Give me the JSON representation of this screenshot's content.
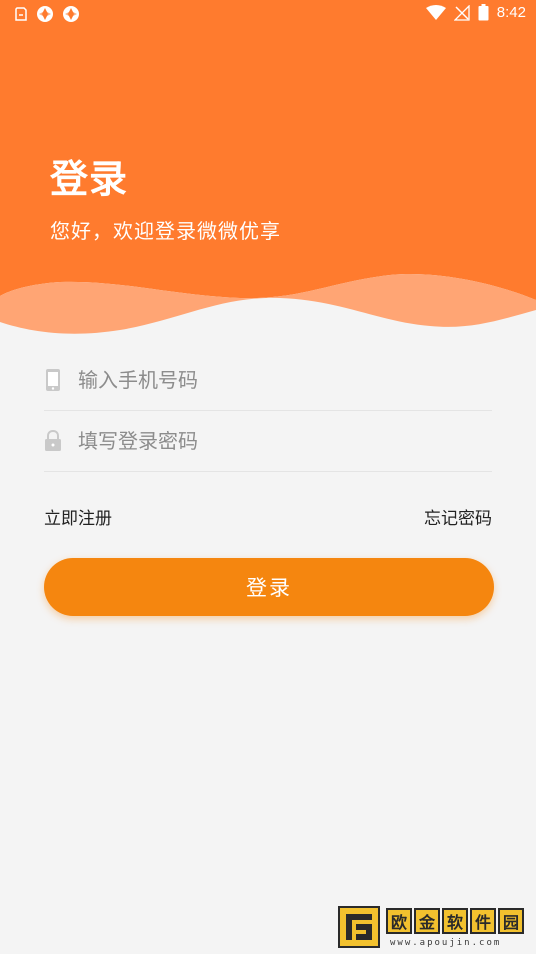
{
  "status_bar": {
    "time": "8:42"
  },
  "header": {
    "title": "登录",
    "subtitle": "您好，欢迎登录微微优享"
  },
  "form": {
    "phone_placeholder": "输入手机号码",
    "password_placeholder": "填写登录密码"
  },
  "links": {
    "register": "立即注册",
    "forgot_password": "忘记密码"
  },
  "login_button": "登录",
  "watermark": {
    "chars": [
      "欧",
      "金",
      "软",
      "件",
      "园"
    ],
    "url": "www.apoujin.com"
  },
  "colors": {
    "header_orange": "#ff7b2e",
    "wave_light": "#ffa574",
    "button_orange": "#f5860f",
    "background": "#f4f4f4"
  },
  "icons": {
    "phone_field": "phone-icon",
    "password_field": "lock-icon"
  }
}
